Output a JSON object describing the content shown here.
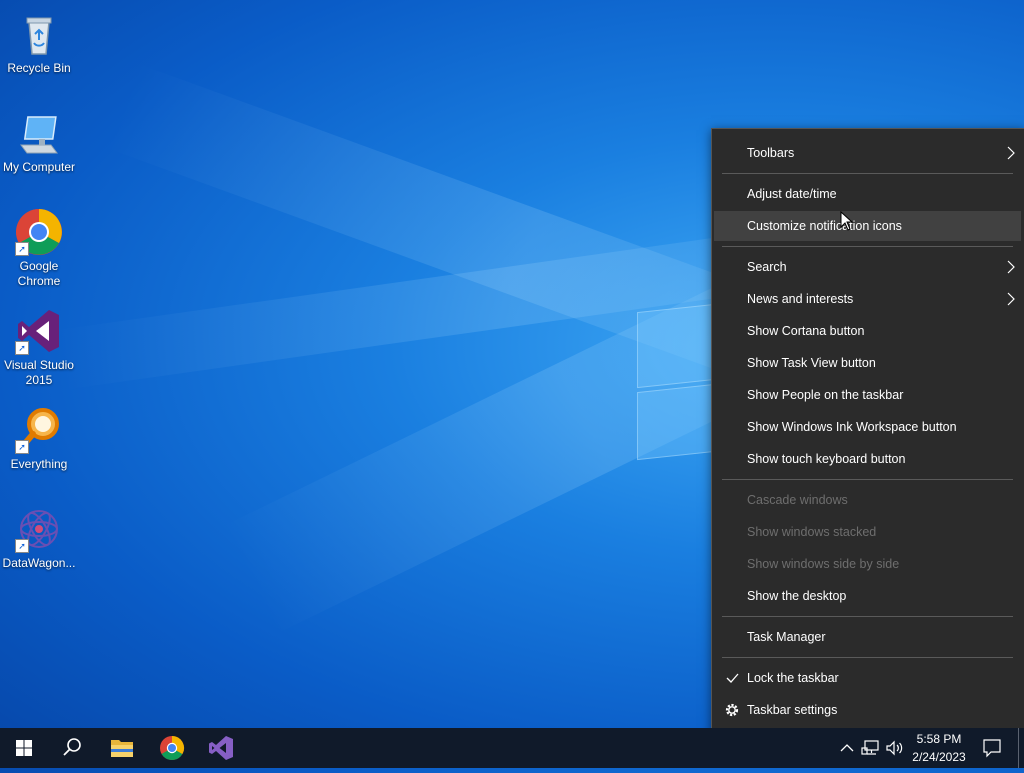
{
  "desktop": {
    "icons": [
      {
        "label": "Recycle Bin",
        "icon": "recycle-bin-icon"
      },
      {
        "label": "My Computer",
        "icon": "computer-icon"
      },
      {
        "label": "Google Chrome",
        "icon": "chrome-icon"
      },
      {
        "label": "Visual Studio 2015",
        "icon": "visual-studio-icon"
      },
      {
        "label": "Everything",
        "icon": "everything-search-icon"
      },
      {
        "label": "DataWagon...",
        "icon": "datawagon-icon"
      }
    ]
  },
  "context_menu": {
    "items": [
      {
        "label": "Toolbars",
        "submenu": true
      },
      {
        "label": "Adjust date/time"
      },
      {
        "label": "Customize notification icons",
        "highlighted": true
      },
      {
        "label": "Search",
        "submenu": true
      },
      {
        "label": "News and interests",
        "submenu": true
      },
      {
        "label": "Show Cortana button"
      },
      {
        "label": "Show Task View button"
      },
      {
        "label": "Show People on the taskbar"
      },
      {
        "label": "Show Windows Ink Workspace button"
      },
      {
        "label": "Show touch keyboard button"
      },
      {
        "label": "Cascade windows",
        "disabled": true
      },
      {
        "label": "Show windows stacked",
        "disabled": true
      },
      {
        "label": "Show windows side by side",
        "disabled": true
      },
      {
        "label": "Show the desktop"
      },
      {
        "label": "Task Manager"
      },
      {
        "label": "Lock the taskbar",
        "checked": true
      },
      {
        "label": "Taskbar settings",
        "icon": "gear-icon"
      }
    ]
  },
  "taskbar": {
    "pinned": [
      "start-button",
      "search-button",
      "file-explorer",
      "google-chrome",
      "visual-studio"
    ],
    "tray": {
      "time": "5:58 PM",
      "date": "2/24/2023"
    }
  },
  "colors": {
    "menu_bg": "#2b2b2b",
    "menu_highlight": "#414141",
    "taskbar_bg": "#101a2a",
    "disabled_text": "#6e6e6e"
  }
}
